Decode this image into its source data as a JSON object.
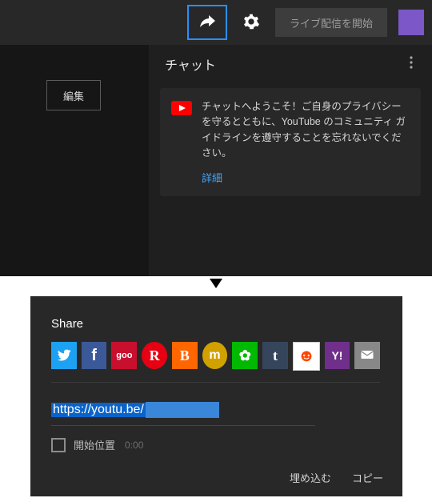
{
  "topbar": {
    "go_live_label": "ライブ配信を開始"
  },
  "sidebar": {
    "edit_label": "編集"
  },
  "chat": {
    "title": "チャット",
    "welcome_text": "チャットへようこそ！ご自身のプライバシーを守るとともに、YouTube のコミュニティ ガイドラインを遵守することを忘れないでください。",
    "learn_more": "詳細"
  },
  "share": {
    "title": "Share",
    "services": [
      {
        "name": "twitter",
        "label": "t"
      },
      {
        "name": "facebook",
        "label": "f"
      },
      {
        "name": "goo",
        "label": "goo"
      },
      {
        "name": "ameba",
        "label": "R"
      },
      {
        "name": "blogger",
        "label": "B"
      },
      {
        "name": "mixi",
        "label": "m"
      },
      {
        "name": "line",
        "label": "✿"
      },
      {
        "name": "tumblr",
        "label": "t"
      },
      {
        "name": "reddit",
        "label": "☺"
      },
      {
        "name": "yahoo",
        "label": "Y!"
      },
      {
        "name": "mail",
        "label": "✉"
      }
    ],
    "url_visible_prefix": "https://youtu.be/",
    "start_at_label": "開始位置",
    "start_at_time": "0:00",
    "embed_label": "埋め込む",
    "copy_label": "コピー"
  }
}
